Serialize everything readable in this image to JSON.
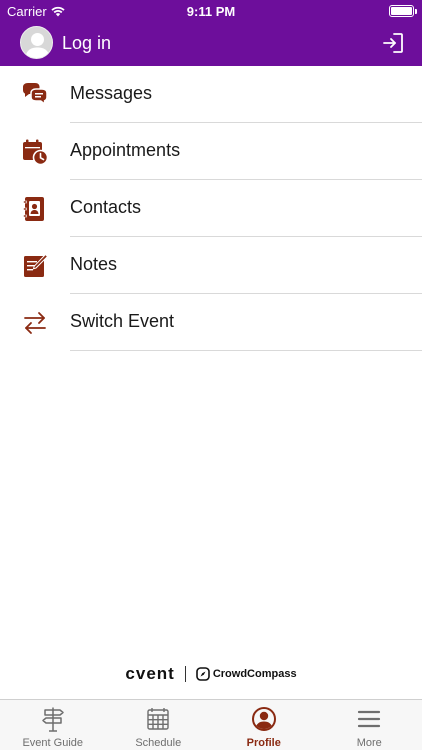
{
  "status_bar": {
    "carrier": "Carrier",
    "time": "9:11 PM"
  },
  "navbar": {
    "title": "Log in",
    "avatar_icon": "person-placeholder-icon",
    "login_icon": "sign-in-icon"
  },
  "colors": {
    "header": "#6d0e9b",
    "icon_accent": "#8a2a12",
    "tab_active": "#8a2a12",
    "tab_inactive": "#6e6e6e"
  },
  "menu": {
    "items": [
      {
        "label": "Messages",
        "icon": "chat-bubbles-icon"
      },
      {
        "label": "Appointments",
        "icon": "calendar-clock-icon"
      },
      {
        "label": "Contacts",
        "icon": "address-book-icon"
      },
      {
        "label": "Notes",
        "icon": "note-pencil-icon"
      },
      {
        "label": "Switch Event",
        "icon": "switch-arrows-icon"
      }
    ]
  },
  "branding": {
    "left": "cvent",
    "right": "CrowdCompass"
  },
  "tabbar": {
    "tabs": [
      {
        "label": "Event Guide",
        "icon": "signpost-icon",
        "active": false
      },
      {
        "label": "Schedule",
        "icon": "calendar-grid-icon",
        "active": false
      },
      {
        "label": "Profile",
        "icon": "profile-circle-icon",
        "active": true
      },
      {
        "label": "More",
        "icon": "hamburger-menu-icon",
        "active": false
      }
    ]
  }
}
